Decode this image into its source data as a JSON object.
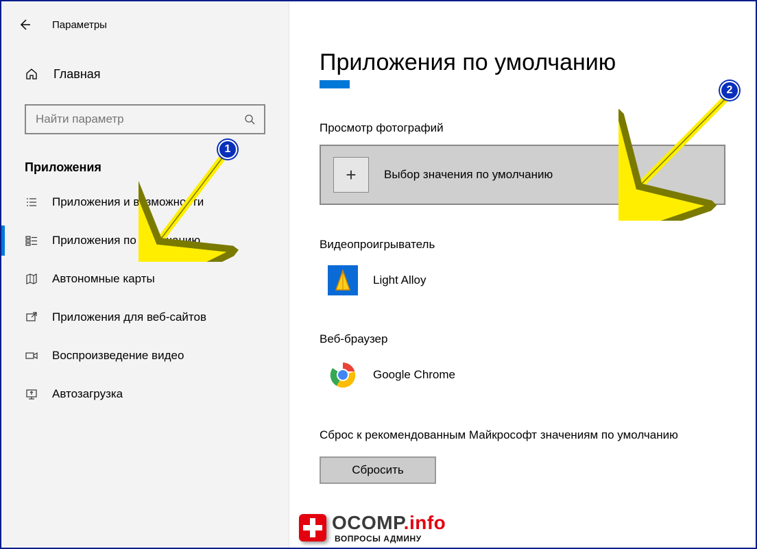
{
  "window": {
    "title": "Параметры"
  },
  "sidebar": {
    "home": "Главная",
    "search_placeholder": "Найти параметр",
    "section": "Приложения",
    "items": [
      {
        "label": "Приложения и возможности"
      },
      {
        "label": "Приложения по умолчанию",
        "active": true
      },
      {
        "label": "Автономные карты"
      },
      {
        "label": "Приложения для веб-сайтов"
      },
      {
        "label": "Воспроизведение видео"
      },
      {
        "label": "Автозагрузка"
      }
    ]
  },
  "main": {
    "title": "Приложения по умолчанию",
    "photo_label": "Просмотр фотографий",
    "choose_default": "Выбор значения по умолчанию",
    "video_label": "Видеопроигрыватель",
    "video_app": "Light Alloy",
    "browser_label": "Веб-браузер",
    "browser_app": "Google Chrome",
    "reset_text": "Сброс к рекомендованным Майкрософт значениям по умолчанию",
    "reset_button": "Сбросить"
  },
  "annotations": {
    "badge1": "1",
    "badge2": "2"
  },
  "watermark": {
    "main1": "OCOMP",
    "main2": ".info",
    "sub": "ВОПРОСЫ АДМИНУ"
  }
}
